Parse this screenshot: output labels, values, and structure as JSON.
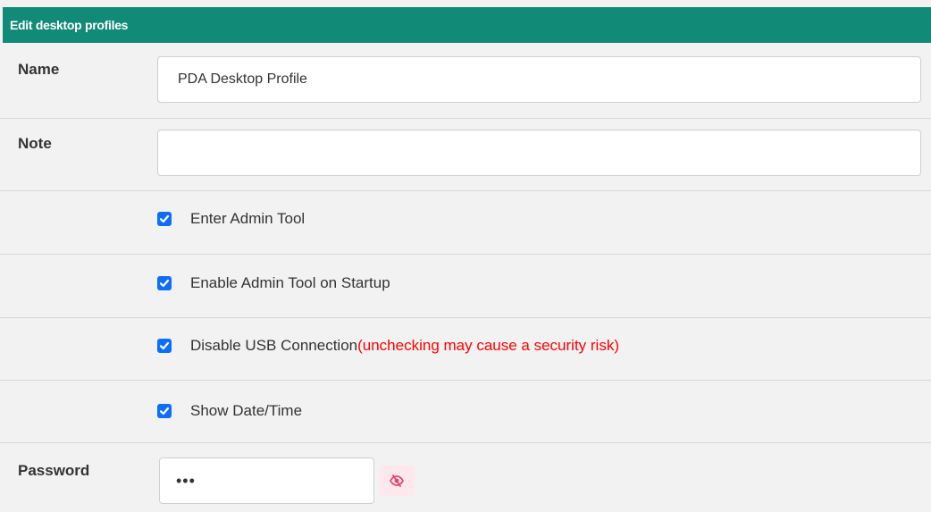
{
  "panel": {
    "title": "Edit desktop profiles"
  },
  "fields": {
    "name": {
      "label": "Name",
      "value": "PDA Desktop Profile"
    },
    "note": {
      "label": "Note",
      "value": ""
    },
    "password": {
      "label": "Password",
      "value": "•••"
    }
  },
  "checkboxes": [
    {
      "label": "Enter Admin Tool",
      "checked": true,
      "note": ""
    },
    {
      "label": "Enable Admin Tool on Startup",
      "checked": true,
      "note": ""
    },
    {
      "label": "Disable USB Connection",
      "checked": true,
      "note": "(unchecking may cause a security risk)"
    },
    {
      "label": "Show Date/Time",
      "checked": true,
      "note": ""
    }
  ],
  "icons": {
    "checkbox_checked": "check-icon",
    "password_toggle": "eye-slash-icon"
  },
  "colors": {
    "header_bg": "#128a78",
    "checkbox": "#0d6efd",
    "warning": "#ff0000",
    "toggle_icon": "#e8436f"
  }
}
